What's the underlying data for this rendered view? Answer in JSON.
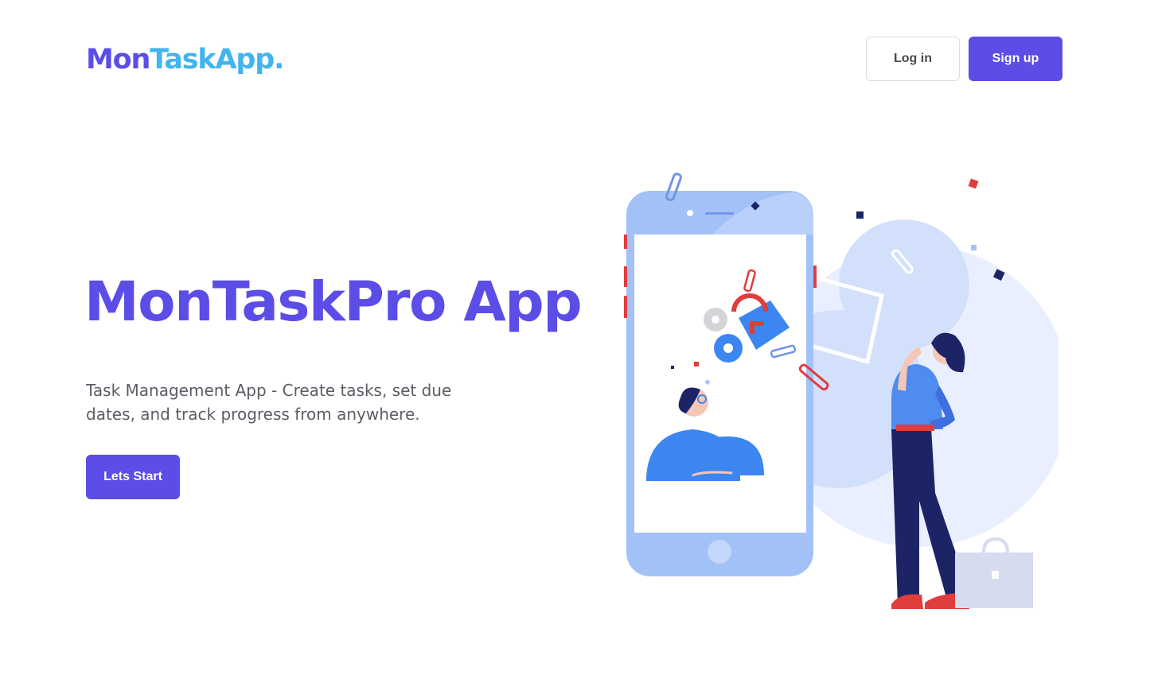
{
  "header": {
    "logo_part1": "Mon",
    "logo_part2": "TaskApp.",
    "login_label": "Log in",
    "signup_label": "Sign up"
  },
  "hero": {
    "title": "MonTaskPro App",
    "description": "Task Management App - Create tasks, set due dates, and track progress from anywhere.",
    "cta_label": "Lets Start"
  },
  "colors": {
    "primary": "#5b4de6",
    "logo_accent": "#42b4ef",
    "illustration_blue": "#a2c2f7",
    "illustration_navy": "#1d2466",
    "illustration_red": "#e03d3d"
  },
  "icons": [
    "phone-illustration",
    "woman-illustration",
    "bag-icon",
    "gear-icon",
    "paperclip-icon"
  ]
}
